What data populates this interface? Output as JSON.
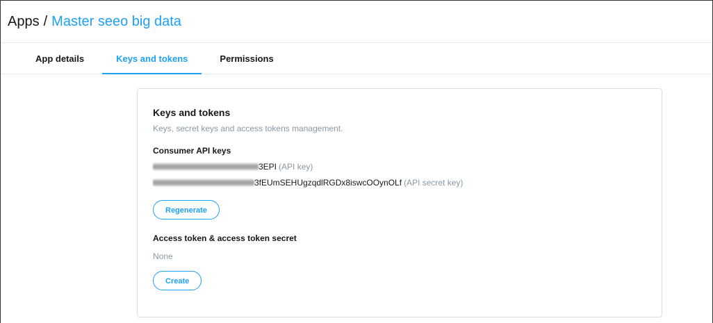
{
  "breadcrumb": {
    "root": "Apps",
    "separator": "/",
    "app_name": "Master seeo big data"
  },
  "tabs": [
    {
      "label": "App details",
      "active": false
    },
    {
      "label": "Keys and tokens",
      "active": true
    },
    {
      "label": "Permissions",
      "active": false
    }
  ],
  "card": {
    "title": "Keys and tokens",
    "subtitle": "Keys, secret keys and access tokens management.",
    "consumer": {
      "heading": "Consumer API keys",
      "api_key": {
        "visible_value": "3EPI",
        "label": "(API key)"
      },
      "api_secret_key": {
        "visible_value": "3fEUmSEHUgzqdlRGDx8iswcOOynOLf",
        "label": "(API secret key)"
      },
      "regenerate_label": "Regenerate"
    },
    "access": {
      "heading": "Access token & access token secret",
      "status": "None",
      "create_label": "Create"
    }
  },
  "colors": {
    "accent": "#1da1f2",
    "muted_text": "#8899a6",
    "border": "#e6ecf0"
  }
}
